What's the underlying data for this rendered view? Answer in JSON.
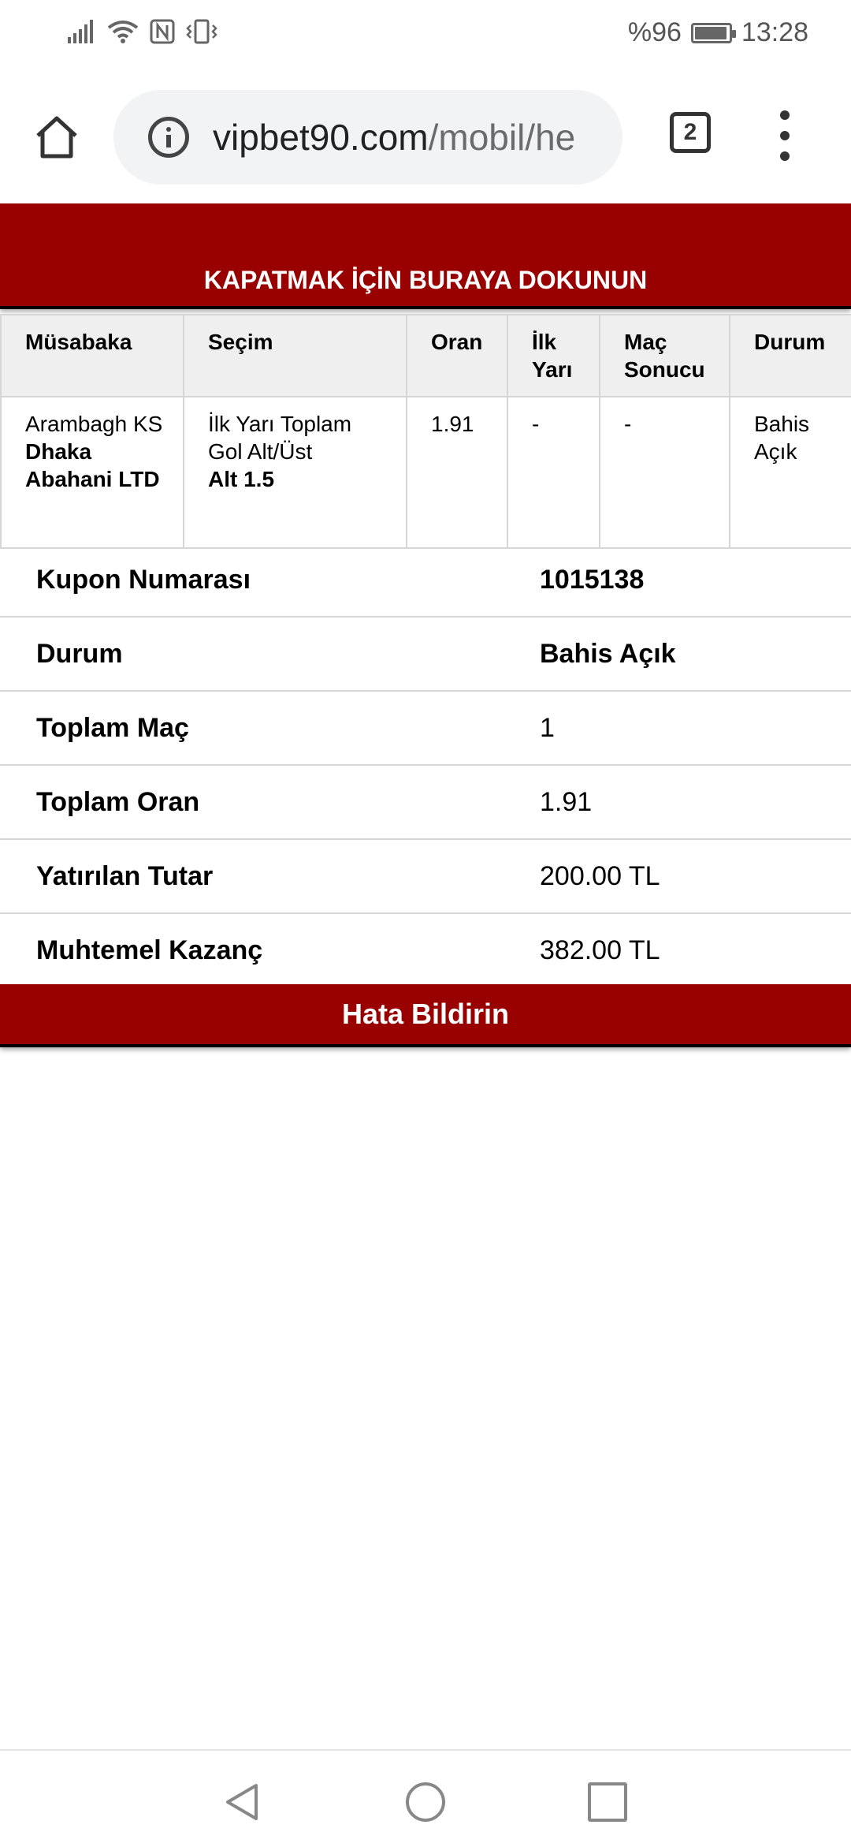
{
  "status_bar": {
    "battery_text": "%96",
    "battery_level": 0.96,
    "time": "13:28",
    "icons": [
      "signal-icon",
      "wifi-icon",
      "nfc-icon",
      "vibrate-icon",
      "battery-icon"
    ]
  },
  "browser": {
    "url_host": "vipbet90.com",
    "url_path": "/mobil/he",
    "tab_count": "2",
    "icons": [
      "home-icon",
      "info-icon",
      "tabs-icon",
      "more-vert-icon"
    ]
  },
  "close_bar": {
    "label": "KAPATMAK İÇİN BURAYA DOKUNUN"
  },
  "bet_table": {
    "headers": {
      "event": "Müsabaka",
      "selection": "Seçim",
      "odds": "Oran",
      "first_half": "İlk Yarı",
      "match_result": "Maç Sonucu",
      "status": "Durum"
    },
    "rows": [
      {
        "home_team": "Arambagh KS",
        "away_team": "Dhaka Abahani LTD",
        "market": "İlk Yarı Toplam Gol Alt/Üst",
        "pick": "Alt 1.5",
        "odds": "1.91",
        "first_half": "-",
        "match_result": "-",
        "status": "Bahis Açık"
      }
    ]
  },
  "summary": [
    {
      "label": "Kupon Numarası",
      "value": "1015138",
      "bold_value": true
    },
    {
      "label": "Durum",
      "value": "Bahis Açık",
      "bold_value": true
    },
    {
      "label": "Toplam Maç",
      "value": "1",
      "bold_value": false
    },
    {
      "label": "Toplam Oran",
      "value": "1.91",
      "bold_value": false
    },
    {
      "label": "Yatırılan Tutar",
      "value": "200.00 TL",
      "bold_value": false
    },
    {
      "label": "Muhtemel Kazanç",
      "value": "382.00 TL",
      "bold_value": false
    }
  ],
  "error_button": {
    "label": "Hata Bildirin"
  },
  "nav_bar": {
    "icons": [
      "back-icon",
      "home-circle-icon",
      "recents-icon"
    ]
  },
  "colors": {
    "accent_red": "#990000",
    "url_bg": "#f1f3f4",
    "border": "#d6d6d6",
    "header_bg": "#efefef"
  }
}
